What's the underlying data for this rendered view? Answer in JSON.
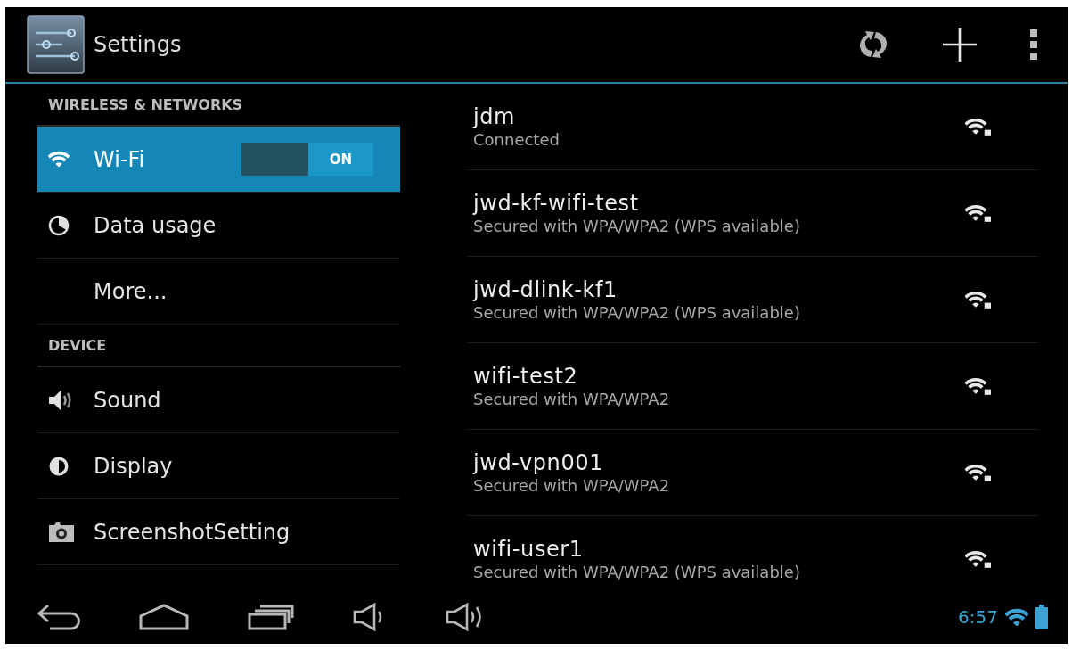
{
  "action_bar": {
    "title": "Settings"
  },
  "sidebar": {
    "sections": [
      {
        "header": "WIRELESS & NETWORKS",
        "items": [
          {
            "label": "Wi-Fi",
            "selected": true,
            "switch": {
              "on": true,
              "label": "ON"
            }
          },
          {
            "label": "Data usage",
            "selected": false
          },
          {
            "label": "More...",
            "selected": false
          }
        ]
      },
      {
        "header": "DEVICE",
        "items": [
          {
            "label": "Sound",
            "selected": false
          },
          {
            "label": "Display",
            "selected": false
          },
          {
            "label": "ScreenshotSetting",
            "selected": false
          }
        ]
      }
    ]
  },
  "networks": [
    {
      "name": "jdm",
      "status": "Connected"
    },
    {
      "name": "jwd-kf-wifi-test",
      "status": "Secured with WPA/WPA2 (WPS available)"
    },
    {
      "name": "jwd-dlink-kf1",
      "status": "Secured with WPA/WPA2 (WPS available)"
    },
    {
      "name": "wifi-test2",
      "status": "Secured with WPA/WPA2"
    },
    {
      "name": "jwd-vpn001",
      "status": "Secured with WPA/WPA2"
    },
    {
      "name": "wifi-user1",
      "status": "Secured with WPA/WPA2 (WPS available)"
    }
  ],
  "status_bar": {
    "time": "6:57"
  }
}
